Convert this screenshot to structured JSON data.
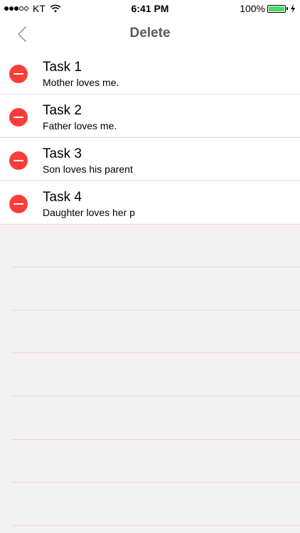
{
  "status_bar": {
    "carrier": "KT",
    "time": "6:41 PM",
    "battery_percent": "100%",
    "battery_level": 1.0,
    "battery_color": "#4cd964",
    "signal_strength": 3,
    "signal_total": 5
  },
  "nav": {
    "title": "Delete",
    "back_icon": "chevron-left-icon"
  },
  "tasks": [
    {
      "title": "Task 1",
      "subtitle": "Mother loves me."
    },
    {
      "title": "Task 2",
      "subtitle": "Father loves me."
    },
    {
      "title": "Task 3",
      "subtitle": "Son loves his parent"
    },
    {
      "title": "Task 4",
      "subtitle": "Daughter loves her p"
    }
  ],
  "colors": {
    "delete_red": "#fc3d39",
    "separator": "#f0cfd7",
    "background": "#f2f1f2",
    "title_gray": "#5a5a5a"
  }
}
